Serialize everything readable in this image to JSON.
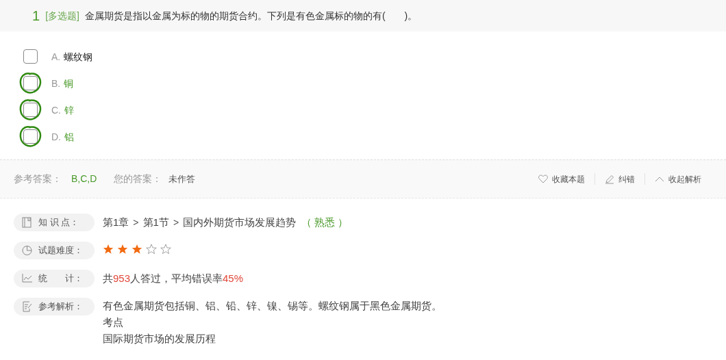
{
  "question": {
    "number": "1",
    "type": "[多选题]",
    "text": "金属期货是指以金属为标的物的期货合约。下列是有色金属标的物的有(　　)。"
  },
  "options": [
    {
      "letter": "A.",
      "text": "螺纹钢",
      "checked": false,
      "correct": false
    },
    {
      "letter": "B.",
      "text": "铜",
      "checked": false,
      "correct": true
    },
    {
      "letter": "C.",
      "text": "锌",
      "checked": false,
      "correct": true
    },
    {
      "letter": "D.",
      "text": "铝",
      "checked": false,
      "correct": true
    }
  ],
  "answer_bar": {
    "reference_label": "参考答案：",
    "reference": "B,C,D",
    "yours_label": "您的答案：",
    "yours": "未作答",
    "actions": [
      {
        "kind": "favorite",
        "label": "收藏本题"
      },
      {
        "kind": "report",
        "label": "纠错"
      },
      {
        "kind": "collapse",
        "label": "收起解析"
      }
    ]
  },
  "analysis": [
    {
      "kind": "knowledge",
      "label": "知 识 点：",
      "path": [
        {
          "kind": "item",
          "text": "第1章"
        },
        {
          "kind": "sep",
          "text": ">"
        },
        {
          "kind": "item",
          "text": "第1节"
        },
        {
          "kind": "sep",
          "text": ">"
        },
        {
          "kind": "item",
          "text": "国内外期货市场发展趋势"
        }
      ],
      "familiarity": "（ 熟悉 ）"
    },
    {
      "kind": "difficulty",
      "label": "试题难度：",
      "stars": 3
    },
    {
      "kind": "stats",
      "label": "统　　计：",
      "parts": [
        {
          "kind": "plain",
          "text": "共"
        },
        {
          "kind": "number",
          "text": "953"
        },
        {
          "kind": "plain",
          "text": "人答过，平均错误率"
        },
        {
          "kind": "number",
          "text": "45%"
        }
      ]
    },
    {
      "kind": "explanation",
      "label": "参考解析：",
      "lines": [
        "有色金属期货包括铜、铝、铅、锌、镍、锡等。螺纹钢属于黑色金属期货。",
        "考点",
        "国际期货市场的发展历程"
      ]
    }
  ]
}
